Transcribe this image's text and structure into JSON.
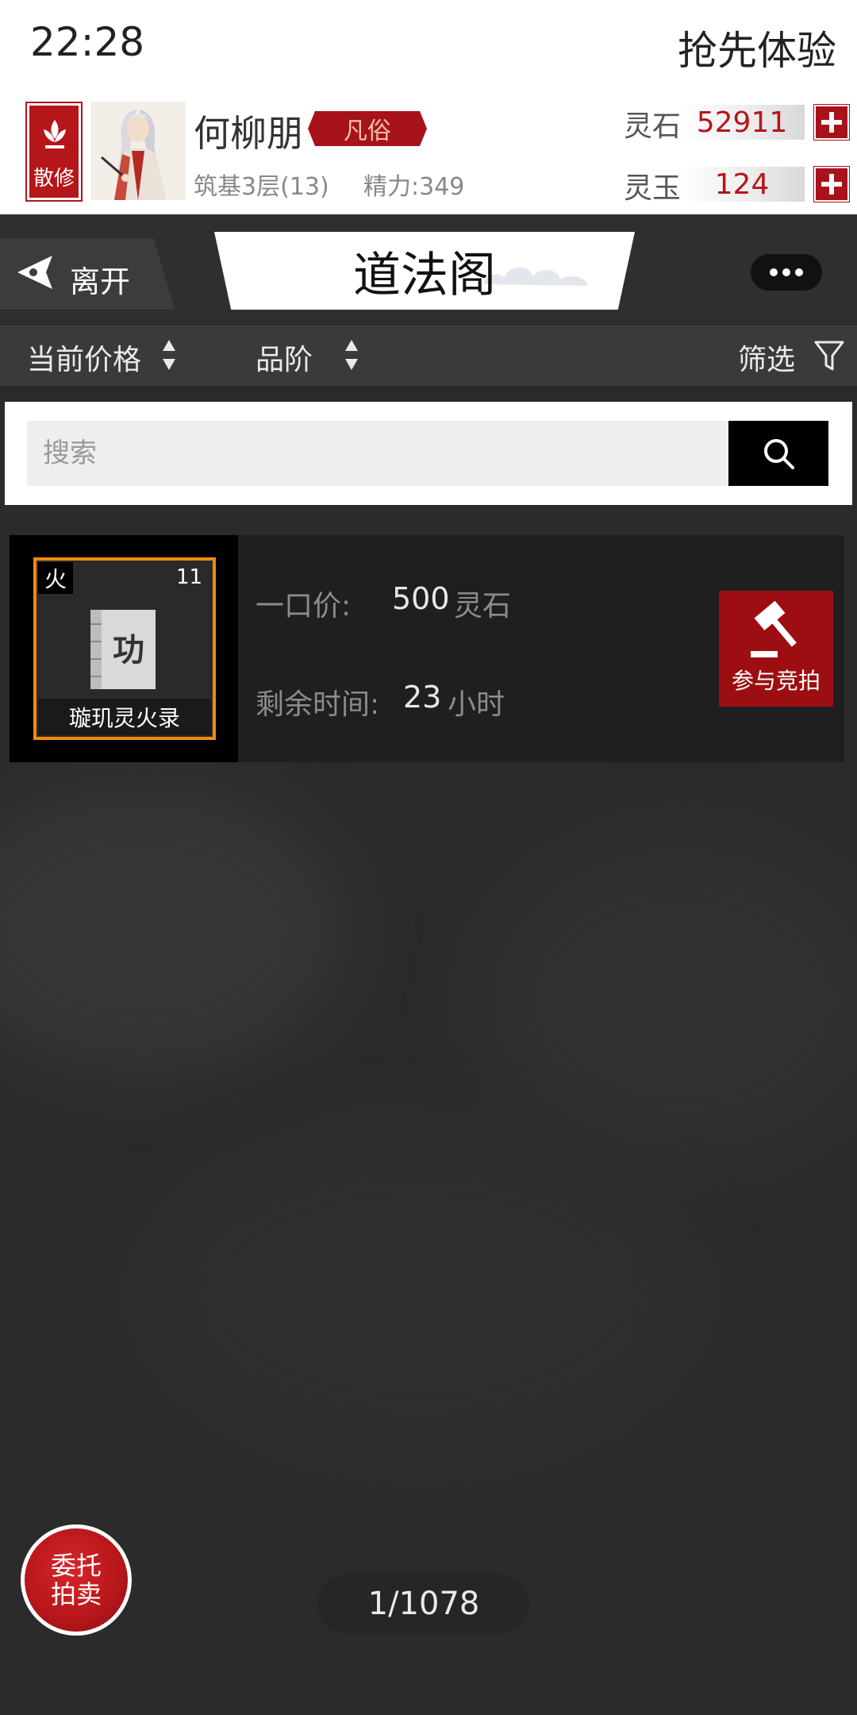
{
  "status_bar": {
    "time": "22:28",
    "right_text": "抢先体验"
  },
  "player": {
    "sect_label": "散修",
    "name": "何柳朋",
    "rank_tag": "凡俗",
    "realm": "筑基3层(13)",
    "energy": "精力:349"
  },
  "currencies": [
    {
      "label": "灵石",
      "value": "52911"
    },
    {
      "label": "灵玉",
      "value": "124"
    }
  ],
  "header": {
    "leave_label": "离开",
    "title": "道法阁"
  },
  "sort_bar": {
    "sort_price": "当前价格",
    "sort_grade": "品阶",
    "filter": "筛选"
  },
  "search": {
    "placeholder": "搜索"
  },
  "listing": {
    "element": "火",
    "level": "11",
    "book_glyph": "功",
    "name": "璇玑灵火录",
    "price_label": "一口价:",
    "price_value": "500",
    "price_unit": "灵石",
    "time_label": "剩余时间:",
    "time_value": "23",
    "time_unit": "小时",
    "bid_label": "参与竞拍"
  },
  "bottom": {
    "consign_label_line1": "委托",
    "consign_label_line2": "拍卖",
    "page_indicator": "1/1078"
  },
  "colors": {
    "accent_red": "#b5161a",
    "item_border_orange": "#f08a10",
    "background": "#2b2b2b"
  }
}
